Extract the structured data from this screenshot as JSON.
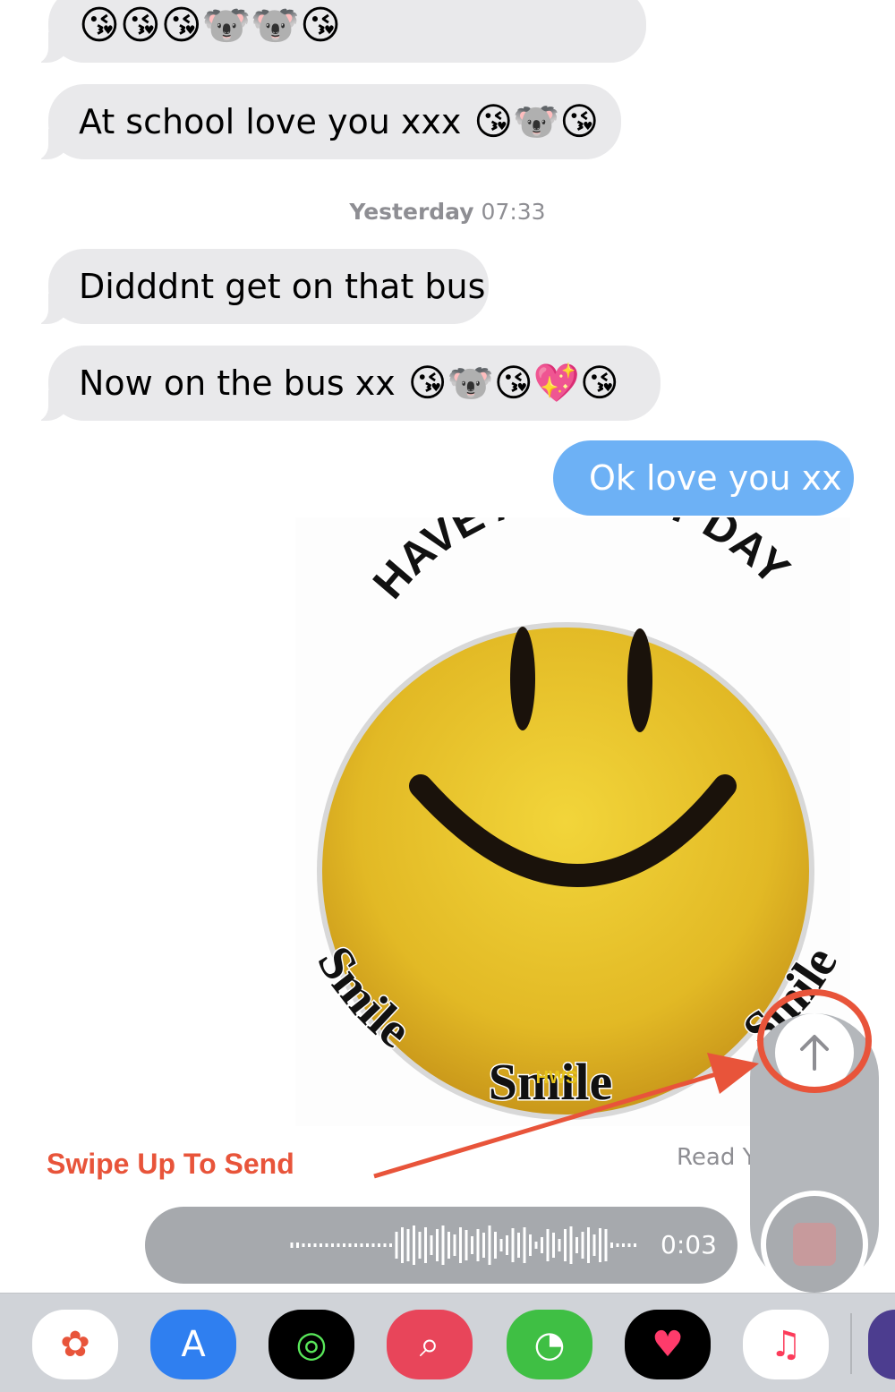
{
  "messages": [
    {
      "id": "m1",
      "type": "incoming",
      "text": "",
      "emojis": "😘😘😘🐨🐨😘"
    },
    {
      "id": "m2",
      "type": "incoming",
      "text": "At school love you xxx",
      "emojis": "😘🐨😘"
    },
    {
      "id": "m3",
      "type": "incoming",
      "text": "Didddnt get on that bus",
      "emojis": ""
    },
    {
      "id": "m4",
      "type": "incoming",
      "text": "Now on the bus xx",
      "emojis": "😘🐨😘💖😘"
    },
    {
      "id": "m5",
      "type": "outgoing",
      "text": "Ok love you xx"
    }
  ],
  "timestamp": {
    "day": "Yesterday",
    "time": "07:33"
  },
  "sticker": {
    "top_text": "HAVE A HAPPY DAY",
    "left_text": "Smile",
    "bottom_text": "Smile",
    "right_text": "Smile",
    "watermark": "HWS"
  },
  "annotation": {
    "label": "Swipe Up To Send",
    "color": "#e8543a"
  },
  "read_receipt": "Read Y",
  "audio": {
    "duration": "0:03"
  },
  "colors": {
    "incoming_bubble": "#e9e9eb",
    "outgoing_bubble": "#6db1f5",
    "annotation": "#e8543a",
    "app_strip": "#d0d3d8"
  },
  "app_drawer": [
    {
      "name": "photos-icon",
      "glyph": "✿",
      "bg": "#ffffff",
      "fg": "#e8543a"
    },
    {
      "name": "app-store-icon",
      "glyph": "A",
      "bg": "#2f7ff0",
      "fg": "#ffffff"
    },
    {
      "name": "activity-icon",
      "glyph": "◎",
      "bg": "#000000",
      "fg": "#59e85a"
    },
    {
      "name": "search-images-icon",
      "glyph": "⌕",
      "bg": "#e8455a",
      "fg": "#ffffff"
    },
    {
      "name": "clock-icon",
      "glyph": "◔",
      "bg": "#3fbf44",
      "fg": "#ffffff"
    },
    {
      "name": "digital-touch-icon",
      "glyph": "♥",
      "bg": "#000000",
      "fg": "#ff3b6b"
    },
    {
      "name": "music-icon",
      "glyph": "♫",
      "bg": "#ffffff",
      "fg": "#fc3c5a"
    }
  ]
}
